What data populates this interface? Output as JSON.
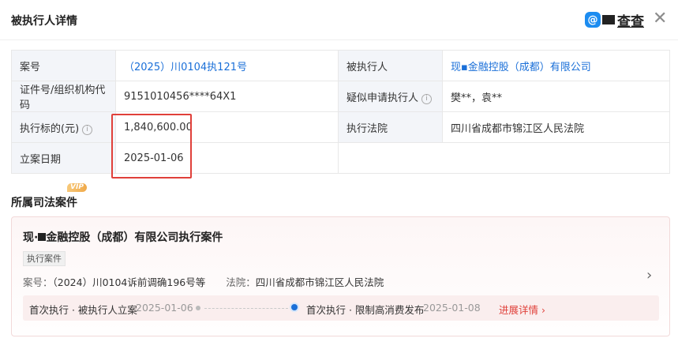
{
  "header": {
    "title": "被执行人详情",
    "brand_mark": "@",
    "brand_text": "查查",
    "close_glyph": "✕"
  },
  "info": {
    "case_no_label": "案号",
    "case_no_value": "（2025）川0104执121号",
    "executee_label": "被执行人",
    "executee_value": "现▪金融控股（成都）有限公司",
    "id_label": "证件号/组织机构代码",
    "id_value": "9151010456****64X1",
    "applicant_label": "疑似申请执行人",
    "applicant_value": "樊**，袁**",
    "amount_label": "执行标的(元)",
    "amount_value": "1,840,600.00",
    "court_label": "执行法院",
    "court_value": "四川省成都市锦江区人民法院",
    "date_label": "立案日期",
    "date_value": "2025-01-06",
    "info_icon": "i"
  },
  "section": {
    "title": "所属司法案件",
    "vip_badge": "VIP"
  },
  "case_card": {
    "title_prefix": "现·",
    "title_suffix": "金融控股（成都）有限公司执行案件",
    "tag": "执行案件",
    "case_no_label": "案号：",
    "case_no_value": "（2024）川0104诉前调确196号等",
    "court_label": "法院：",
    "court_value": "四川省成都市锦江区人民法院",
    "chevron": "›",
    "timeline": {
      "event1": "首次执行 · 被执行人立案",
      "date1": "2025-01-06",
      "event2": "首次执行 · 限制高消费发布",
      "date2": "2025-01-08",
      "more": "进展详情 ›"
    }
  },
  "colors": {
    "link": "#1a6fd8",
    "highlight_box": "#e0403a",
    "accent_red": "#e0403a"
  }
}
